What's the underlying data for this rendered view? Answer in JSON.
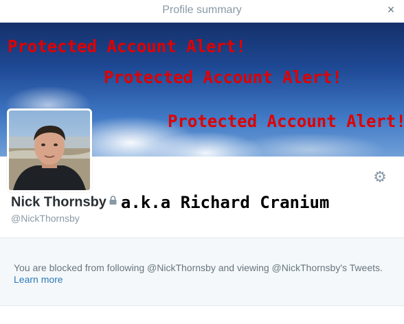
{
  "modal": {
    "title": "Profile summary",
    "close_icon": "close-icon",
    "close_glyph": "×"
  },
  "banner": {
    "alerts": [
      "Protected Account Alert!",
      "Protected Account Alert!",
      "Protected Account Alert!"
    ],
    "alert_color": "#e00000"
  },
  "profile": {
    "display_name": "Nick Thornsby",
    "aka_annotation": "a.k.a Richard Cranium",
    "handle": "@NickThornsby",
    "lock_icon": "lock-icon",
    "settings_icon": "gear-icon",
    "settings_glyph": "⚙"
  },
  "blocked": {
    "message": "You are blocked from following @NickThornsby and viewing @NickThornsby's Tweets.",
    "learn_more": "Learn more",
    "link_color": "#2b7bb9"
  }
}
